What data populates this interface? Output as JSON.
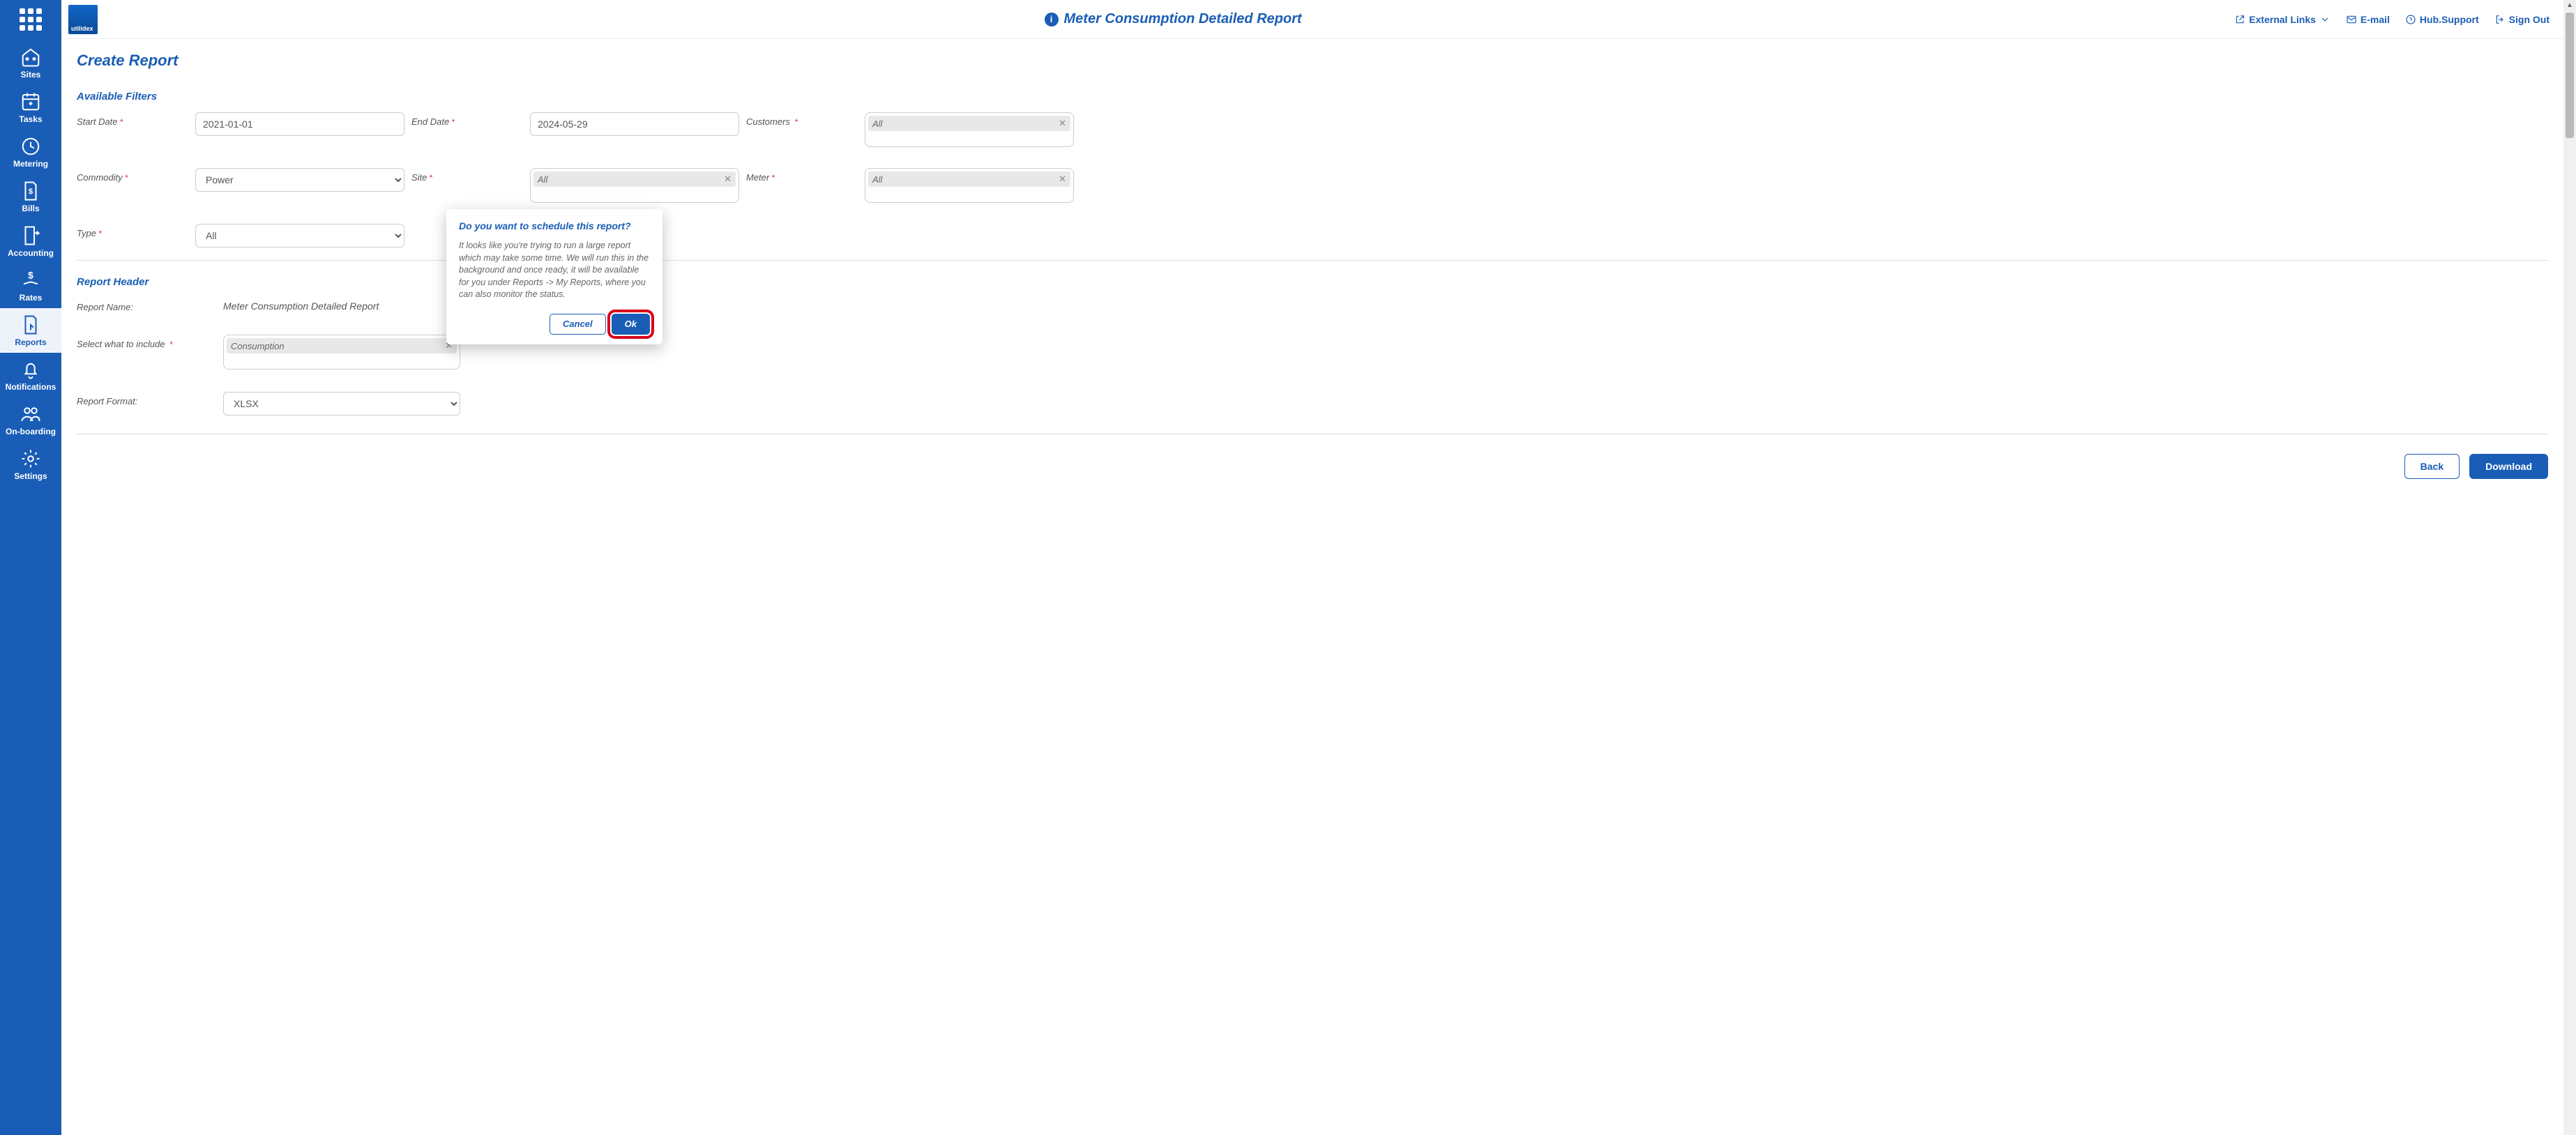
{
  "topbar": {
    "logo_text": "utilidex",
    "title": "Meter Consumption Detailed Report",
    "links": {
      "external": "External Links",
      "email": "E-mail",
      "support": "Hub.Support",
      "signout": "Sign Out"
    }
  },
  "sidebar": {
    "items": [
      {
        "id": "sites",
        "label": "Sites"
      },
      {
        "id": "tasks",
        "label": "Tasks"
      },
      {
        "id": "metering",
        "label": "Metering"
      },
      {
        "id": "bills",
        "label": "Bills"
      },
      {
        "id": "accounting",
        "label": "Accounting"
      },
      {
        "id": "rates",
        "label": "Rates"
      },
      {
        "id": "reports",
        "label": "Reports",
        "active": true
      },
      {
        "id": "notifications",
        "label": "Notifications"
      },
      {
        "id": "onboarding",
        "label": "On-boarding"
      },
      {
        "id": "settings",
        "label": "Settings"
      }
    ]
  },
  "panel": {
    "title": "Create Report",
    "filters_heading": "Available Filters",
    "labels": {
      "start_date": "Start Date",
      "end_date": "End Date",
      "customers": "Customers",
      "commodity": "Commodity",
      "site": "Site",
      "meter": "Meter",
      "type": "Type"
    },
    "values": {
      "start_date": "2021-01-01",
      "end_date": "2024-05-29",
      "customers_chip": "All",
      "commodity": "Power",
      "site_chip": "All",
      "meter_chip": "All",
      "type": "All"
    },
    "header_heading": "Report Header",
    "header_labels": {
      "report_name": "Report Name:",
      "include": "Select what to include",
      "format": "Report Format:"
    },
    "header_values": {
      "report_name": "Meter Consumption Detailed Report",
      "include_chip": "Consumption",
      "format": "XLSX"
    },
    "buttons": {
      "back": "Back",
      "download": "Download"
    }
  },
  "modal": {
    "title": "Do you want to schedule this report?",
    "body": "It looks like you're trying to run a large report which may take some time. We will run this in the background and once ready, it will be available for you under Reports -> My Reports, where you can also monitor the status.",
    "cancel": "Cancel",
    "ok": "Ok"
  }
}
